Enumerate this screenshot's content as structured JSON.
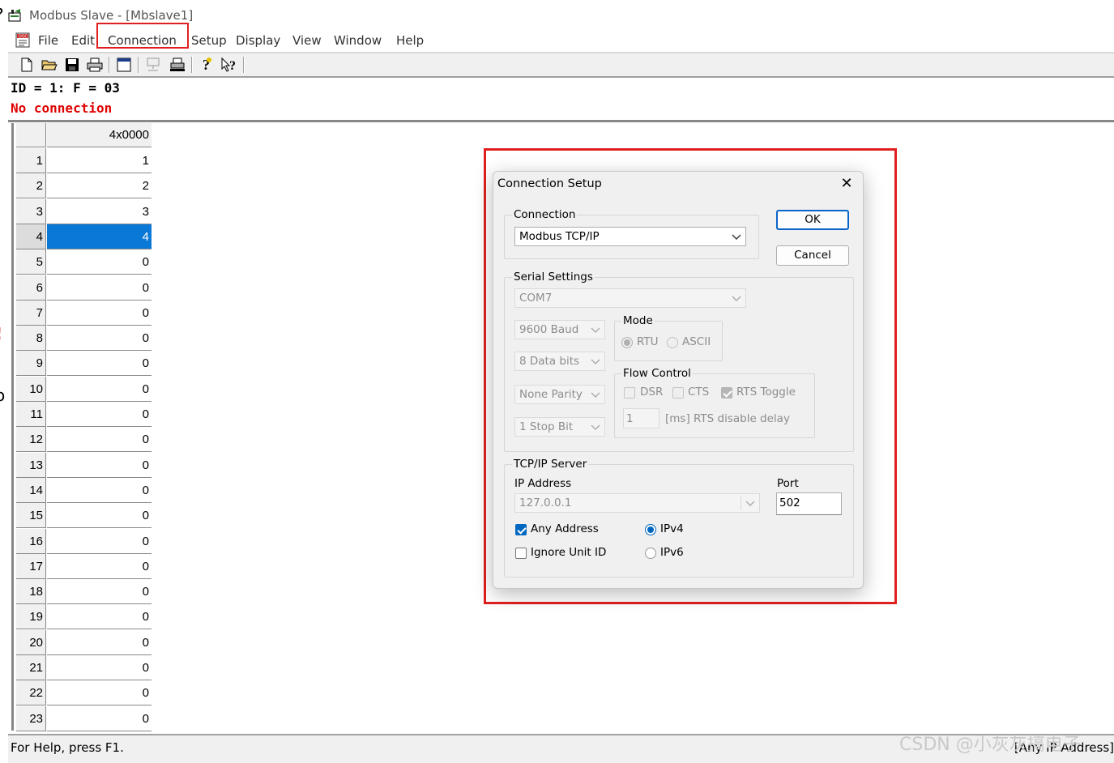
{
  "window": {
    "title": "Modbus Slave - [Mbslave1]",
    "menu": [
      "File",
      "Edit",
      "Connection",
      "Setup",
      "Display",
      "View",
      "Window",
      "Help"
    ],
    "highlighted_menu": "Connection"
  },
  "background_fragments": [
    "?",
    "!",
    "o"
  ],
  "toolbar": {
    "icons": [
      "new-file-icon",
      "open-folder-icon",
      "save-icon",
      "print-icon",
      "window-icon",
      "connect-icon",
      "disconnect-icon",
      "help-icon",
      "context-help-icon"
    ]
  },
  "info": {
    "id_line": "ID = 1: F = 03",
    "status": "No connection"
  },
  "grid": {
    "column_header": "4x0000",
    "selected_row": 4,
    "rows": [
      {
        "n": "1",
        "v": "1"
      },
      {
        "n": "2",
        "v": "2"
      },
      {
        "n": "3",
        "v": "3"
      },
      {
        "n": "4",
        "v": "4"
      },
      {
        "n": "5",
        "v": "0"
      },
      {
        "n": "6",
        "v": "0"
      },
      {
        "n": "7",
        "v": "0"
      },
      {
        "n": "8",
        "v": "0"
      },
      {
        "n": "9",
        "v": "0"
      },
      {
        "n": "10",
        "v": "0"
      },
      {
        "n": "11",
        "v": "0"
      },
      {
        "n": "12",
        "v": "0"
      },
      {
        "n": "13",
        "v": "0"
      },
      {
        "n": "14",
        "v": "0"
      },
      {
        "n": "15",
        "v": "0"
      },
      {
        "n": "16",
        "v": "0"
      },
      {
        "n": "17",
        "v": "0"
      },
      {
        "n": "18",
        "v": "0"
      },
      {
        "n": "19",
        "v": "0"
      },
      {
        "n": "20",
        "v": "0"
      },
      {
        "n": "21",
        "v": "0"
      },
      {
        "n": "22",
        "v": "0"
      },
      {
        "n": "23",
        "v": "0"
      }
    ]
  },
  "statusbar": {
    "help": "For Help, press F1.",
    "right": "[Any IP Address]"
  },
  "watermark": "CSDN @小灰灰搞电子",
  "dialog": {
    "title": "Connection Setup",
    "close": "✕",
    "ok": "OK",
    "cancel": "Cancel",
    "connection_group": "Connection",
    "connection_value": "Modbus TCP/IP",
    "serial_group": "Serial Settings",
    "port": "COM7",
    "baud": "9600 Baud",
    "data_bits": "8 Data bits",
    "parity": "None Parity",
    "stop_bits": "1 Stop Bit",
    "mode_group": "Mode",
    "mode_rtu": "RTU",
    "mode_ascii": "ASCII",
    "mode_selected": "RTU",
    "flow_group": "Flow Control",
    "flow_dsr": "DSR",
    "flow_cts": "CTS",
    "flow_rts": "RTS Toggle",
    "rts_toggle_checked": true,
    "rts_delay": "1",
    "rts_delay_label": "[ms] RTS disable delay",
    "tcp_group": "TCP/IP Server",
    "ip_label": "IP Address",
    "ip_value": "127.0.0.1",
    "port_label": "Port",
    "port_value": "502",
    "any_address": "Any Address",
    "any_address_checked": true,
    "ignore_unit": "Ignore Unit ID",
    "ignore_unit_checked": false,
    "ipv4": "IPv4",
    "ipv6": "IPv6",
    "ip_version_selected": "IPv4"
  },
  "colors": {
    "highlight_red": "#e02020",
    "selection_blue": "#0a78d7",
    "status_red": "#e00000"
  }
}
